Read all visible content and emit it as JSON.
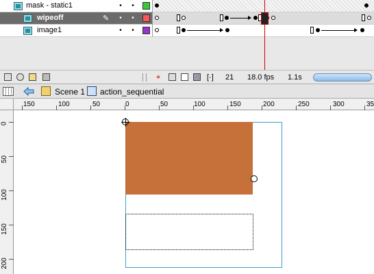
{
  "timeline": {
    "layers": [
      {
        "name": "mask - static1",
        "color": "#33cc33",
        "selected": false
      },
      {
        "name": "wipeoff",
        "color": "#ff5555",
        "selected": true
      },
      {
        "name": "image1",
        "color": "#9933cc",
        "selected": false
      }
    ],
    "footer": {
      "current_frame": "21",
      "fps": "18.0 fps",
      "time": "1.1s"
    }
  },
  "editbar": {
    "scene": "Scene 1",
    "symbol": "action_sequential"
  },
  "rulers": {
    "top": [
      "150",
      "100",
      "50",
      "0",
      "50",
      "100",
      "150",
      "200",
      "250",
      "300",
      "35"
    ],
    "left": [
      "0",
      "50",
      "100",
      "150",
      "200"
    ]
  },
  "colors": {
    "shape_fill": "#c6703a",
    "stage_bounds": "#3aa0c8",
    "playhead": "#d00000"
  }
}
